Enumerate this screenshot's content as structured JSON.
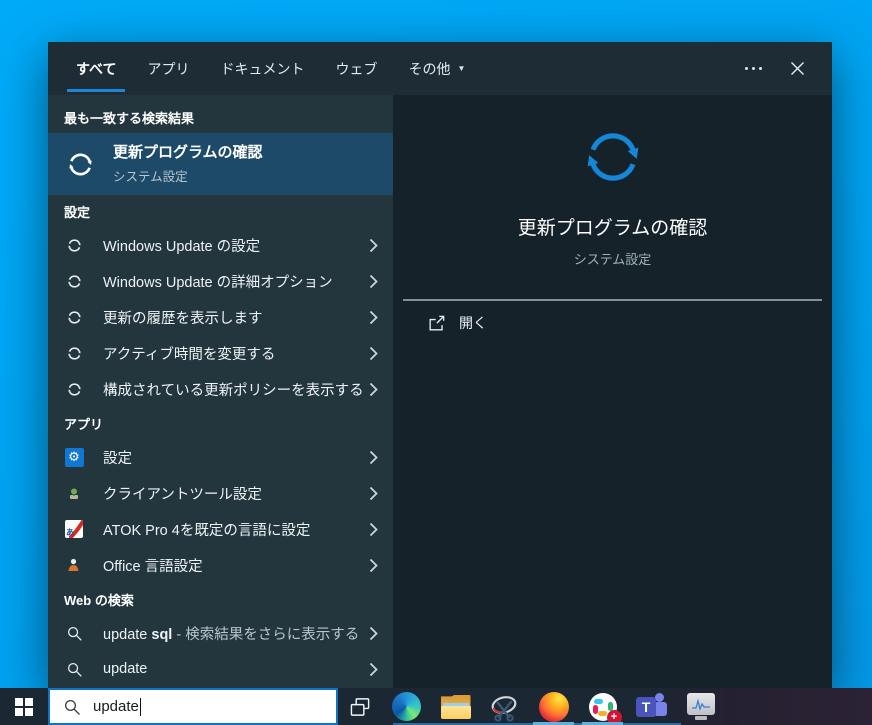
{
  "tabs_bar": {
    "tabs": [
      {
        "label": "すべて"
      },
      {
        "label": "アプリ"
      },
      {
        "label": "ドキュメント"
      },
      {
        "label": "ウェブ"
      },
      {
        "label": "その他"
      }
    ]
  },
  "best_match": {
    "header": "最も一致する検索結果",
    "title": "更新プログラムの確認",
    "subtitle": "システム設定"
  },
  "settings_section": {
    "header": "設定",
    "items": [
      {
        "label": "Windows Update の設定"
      },
      {
        "label": "Windows Update の詳細オプション"
      },
      {
        "label": "更新の履歴を表示します"
      },
      {
        "label": "アクティブ時間を変更する"
      },
      {
        "label": "構成されている更新ポリシーを表示する"
      }
    ]
  },
  "apps_section": {
    "header": "アプリ",
    "items": [
      {
        "label": "設定",
        "icon": "settings-gear-icon"
      },
      {
        "label": "クライアントツール設定",
        "icon": "client-tools-icon"
      },
      {
        "label": "ATOK Pro 4を既定の言語に設定",
        "icon": "atok-icon"
      },
      {
        "label": "Office 言語設定",
        "icon": "office-language-icon"
      }
    ]
  },
  "web_section": {
    "header": "Web の検索",
    "items": [
      {
        "prefix": "update ",
        "bold": "sql",
        "suffix": " - 検索結果をさらに表示する"
      },
      {
        "prefix": "update",
        "bold": "",
        "suffix": ""
      }
    ]
  },
  "preview": {
    "title": "更新プログラムの確認",
    "subtitle": "システム設定",
    "open_label": "開く"
  },
  "taskbar": {
    "search_value": "update",
    "icons": [
      {
        "name": "edge"
      },
      {
        "name": "file-explorer"
      },
      {
        "name": "snipping-tool"
      },
      {
        "name": "firefox"
      },
      {
        "name": "slack"
      },
      {
        "name": "teams"
      },
      {
        "name": "system-monitor"
      }
    ],
    "running_indicators": [
      "firefox",
      "slack"
    ]
  },
  "colors": {
    "accent": "#1a86d9",
    "wallpaper": "#00a6f6",
    "best_match_highlight": "#1c4a68",
    "preview_icon_blue": "#1587d8"
  },
  "glyphs": {
    "settings_gear": "⚙",
    "atok_a": "あ",
    "teams_t": "T",
    "badge_plus": "+"
  }
}
